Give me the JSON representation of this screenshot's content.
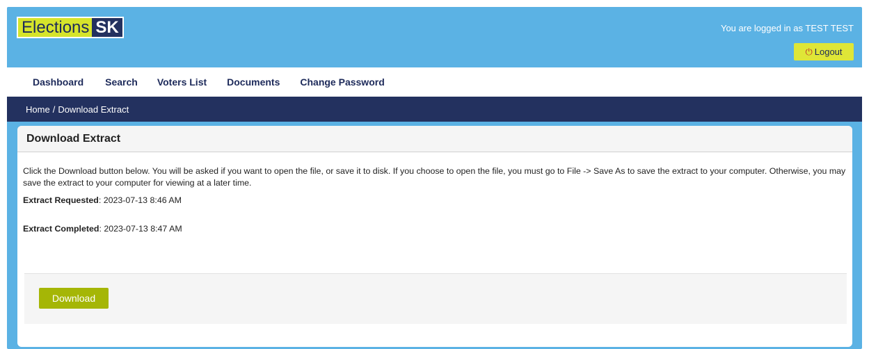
{
  "header": {
    "logo_part1": "Elections",
    "logo_part2": "SK",
    "login_text": "You are logged in as TEST TEST",
    "logout_label": "Logout",
    "logout_icon": "power-icon"
  },
  "nav": {
    "items": [
      {
        "label": "Dashboard"
      },
      {
        "label": "Search"
      },
      {
        "label": "Voters List"
      },
      {
        "label": "Documents"
      },
      {
        "label": "Change Password"
      }
    ]
  },
  "breadcrumb": {
    "home": "Home",
    "separator": "/",
    "current": "Download Extract"
  },
  "panel": {
    "title": "Download Extract",
    "description": "Click the Download button below. You will be asked if you want to open the file, or save it to disk. If you choose to open the file, you must go to File -> Save As to save the extract to your computer. Otherwise, you may save the extract to your computer for viewing at a later time.",
    "requested_label": "Extract Requested",
    "requested_value": ": 2023-07-13 8:46 AM",
    "completed_label": "Extract Completed",
    "completed_value": ": 2023-07-13 8:47 AM",
    "download_label": "Download"
  },
  "colors": {
    "header_bg": "#5bb2e4",
    "navy": "#23315f",
    "logo_yellow": "#d6e42b",
    "logout_yellow": "#dfe637",
    "download_green": "#a5b606"
  }
}
